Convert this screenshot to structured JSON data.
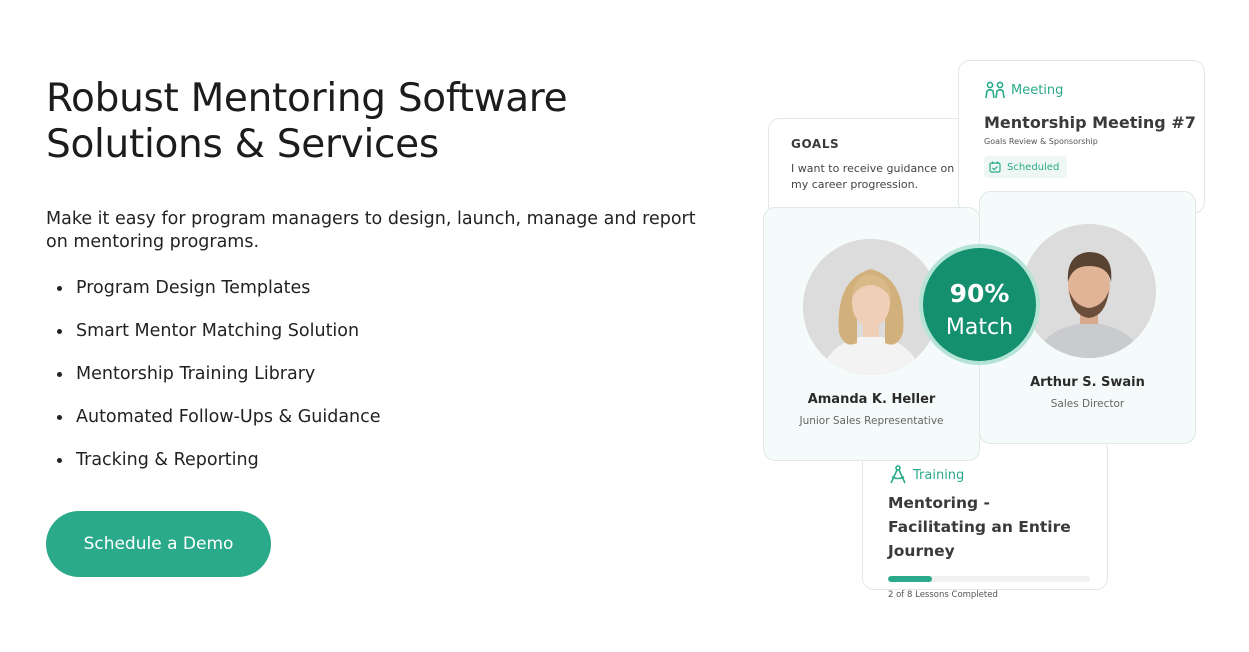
{
  "hero": {
    "title_line1": "Robust Mentoring Software",
    "title_line2": "Solutions & Services",
    "intro": "Make it easy for program managers to design, launch, manage and report on mentoring programs.",
    "features": [
      "Program Design Templates",
      "Smart Mentor Matching Solution",
      "Mentorship Training Library",
      "Automated Follow-Ups & Guidance",
      "Tracking & Reporting"
    ],
    "cta_label": "Schedule a Demo"
  },
  "goals_card": {
    "label": "GOALS",
    "text": "I want to receive guidance on my career progression."
  },
  "meeting_card": {
    "category": "Meeting",
    "title": "Mentorship Meeting #7",
    "subtitle": "Goals Review & Sponsorship",
    "status": "Scheduled"
  },
  "mentee": {
    "name": "Amanda K. Heller",
    "role": "Junior Sales Representative"
  },
  "mentor": {
    "name": "Arthur S. Swain",
    "role": "Sales Director"
  },
  "match": {
    "percent_label": "90%",
    "label": "Match",
    "percent": 90
  },
  "training_card": {
    "category": "Training",
    "title": "Mentoring - Facilitating an Entire Journey",
    "progress_fraction": 0.22,
    "status": "2 of 8 Lessons Completed"
  },
  "colors": {
    "accent": "#2aaa8a",
    "match_bg": "#14906f",
    "match_ring": "#b5e4d6",
    "card_tint": "#f5fbfa"
  },
  "icons": {
    "meeting": "people-icon",
    "scheduled": "calendar-check-icon",
    "training": "compass-icon"
  }
}
